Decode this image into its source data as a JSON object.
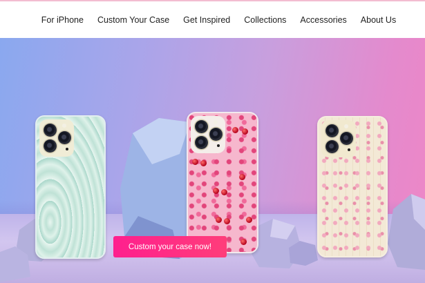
{
  "nav": {
    "items": [
      {
        "label": "For iPhone"
      },
      {
        "label": "Custom Your Case"
      },
      {
        "label": "Get Inspired"
      },
      {
        "label": "Collections"
      },
      {
        "label": "Accessories"
      },
      {
        "label": "About Us"
      }
    ]
  },
  "hero": {
    "cta_label": "Custom your case now!",
    "products": [
      {
        "design": "teal marble wave phone case"
      },
      {
        "design": "pink leopard cherry phone case"
      },
      {
        "design": "cream floral phone case"
      }
    ]
  },
  "colors": {
    "accent": "#ff2a86",
    "nav_text": "#222222",
    "background": "#ffffff"
  }
}
